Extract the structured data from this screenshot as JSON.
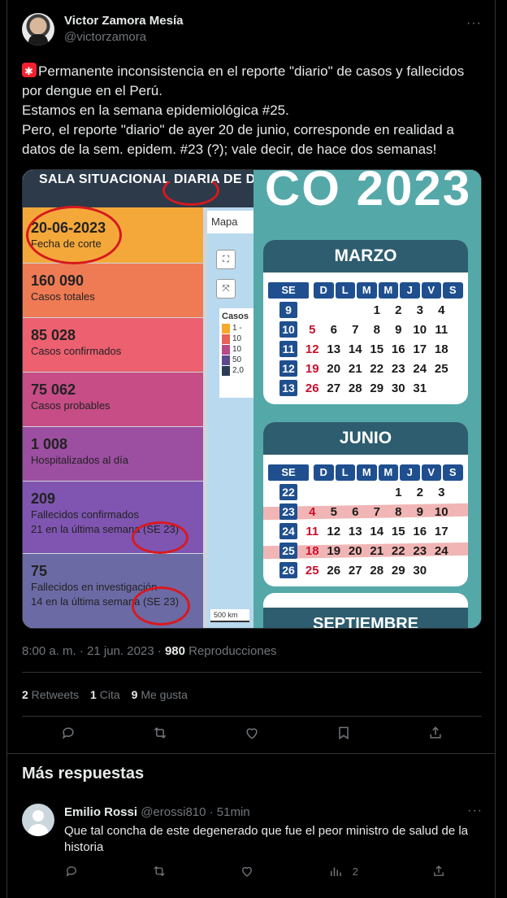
{
  "tweet": {
    "author_name": "Victor Zamora Mesía",
    "author_handle": "@victorzamora",
    "text_lines": [
      "Permanente inconsistencia en el reporte \"diario\" de casos y fallecidos por dengue en el Perú.",
      "Estamos en la semana epidemiológica #25.",
      "Pero, el reporte \"diario\" de ayer 20 de junio, corresponde en realidad a datos de la sem. epidem. #23 (?); vale decir, de hace dos semanas!"
    ],
    "time": "8:00 a. m. · 21 jun. 2023 · ",
    "views_count": "980",
    "views_label": " Reproducciones",
    "retweets_count": "2",
    "retweets_label": " Retweets",
    "quotes_count": "1",
    "quotes_label": " Cita",
    "likes_count": "9",
    "likes_label": " Me gusta"
  },
  "media": {
    "left_panel": {
      "header": "SALA SITUACIONAL DIARIA DE DE",
      "map_tab": "Mapa",
      "legend_title": "Casos",
      "legend_items": [
        "1 -",
        "10",
        "10",
        "50",
        "2,0"
      ],
      "legend_colors": [
        "#f7a82a",
        "#e8615b",
        "#b84a86",
        "#5b4a8c",
        "#2b3d55"
      ],
      "scale": "500 km",
      "cards": [
        {
          "value": "20-06-2023",
          "label": "Fecha de corte",
          "extra": "",
          "color": "#f4a83a"
        },
        {
          "value": "160 090",
          "label": "Casos totales",
          "extra": "",
          "color": "#ef7b55"
        },
        {
          "value": "85 028",
          "label": "Casos confirmados",
          "extra": "",
          "color": "#ec6070"
        },
        {
          "value": "75 062",
          "label": "Casos probables",
          "extra": "",
          "color": "#c64d86"
        },
        {
          "value": "1 008",
          "label": "Hospitalizados al día",
          "extra": "",
          "color": "#9c4ea1"
        },
        {
          "value": "209",
          "label": "Fallecidos confirmados",
          "extra": "21 en la última semana (SE 23)",
          "color": "#7f55b1"
        },
        {
          "value": "75",
          "label": "Fallecidos en investigación",
          "extra": "14 en la última semana (SE 23)",
          "color": "#6b6aa5"
        }
      ]
    },
    "right_panel": {
      "year_banner": "CO 2023",
      "march": {
        "title": "MARZO",
        "header": [
          "SE",
          "D",
          "L",
          "M",
          "M",
          "J",
          "V",
          "S"
        ],
        "rows": [
          [
            "9",
            "",
            "",
            "",
            "1",
            "2",
            "3",
            "4"
          ],
          [
            "10",
            "5",
            "6",
            "7",
            "8",
            "9",
            "10",
            "11"
          ],
          [
            "11",
            "12",
            "13",
            "14",
            "15",
            "16",
            "17",
            "18"
          ],
          [
            "12",
            "19",
            "20",
            "21",
            "22",
            "23",
            "24",
            "25"
          ],
          [
            "13",
            "26",
            "27",
            "28",
            "29",
            "30",
            "31",
            ""
          ]
        ]
      },
      "june": {
        "title": "JUNIO",
        "header": [
          "SE",
          "D",
          "L",
          "M",
          "M",
          "J",
          "V",
          "S"
        ],
        "rows": [
          [
            "22",
            "",
            "",
            "",
            "",
            "1",
            "2",
            "3"
          ],
          [
            "23",
            "4",
            "5",
            "6",
            "7",
            "8",
            "9",
            "10"
          ],
          [
            "24",
            "11",
            "12",
            "13",
            "14",
            "15",
            "16",
            "17"
          ],
          [
            "25",
            "18",
            "19",
            "20",
            "21",
            "22",
            "23",
            "24"
          ],
          [
            "26",
            "25",
            "26",
            "27",
            "28",
            "29",
            "30",
            ""
          ]
        ]
      },
      "next_month": "SEPTIEMBRE"
    }
  },
  "replies_section": {
    "title": "Más respuestas"
  },
  "reply": {
    "name": "Emilio Rossi",
    "handle": "@erossi810 · 51min",
    "text": "Que tal concha de este degenerado que fue el peor ministro de salud de la historia",
    "views": "2"
  }
}
